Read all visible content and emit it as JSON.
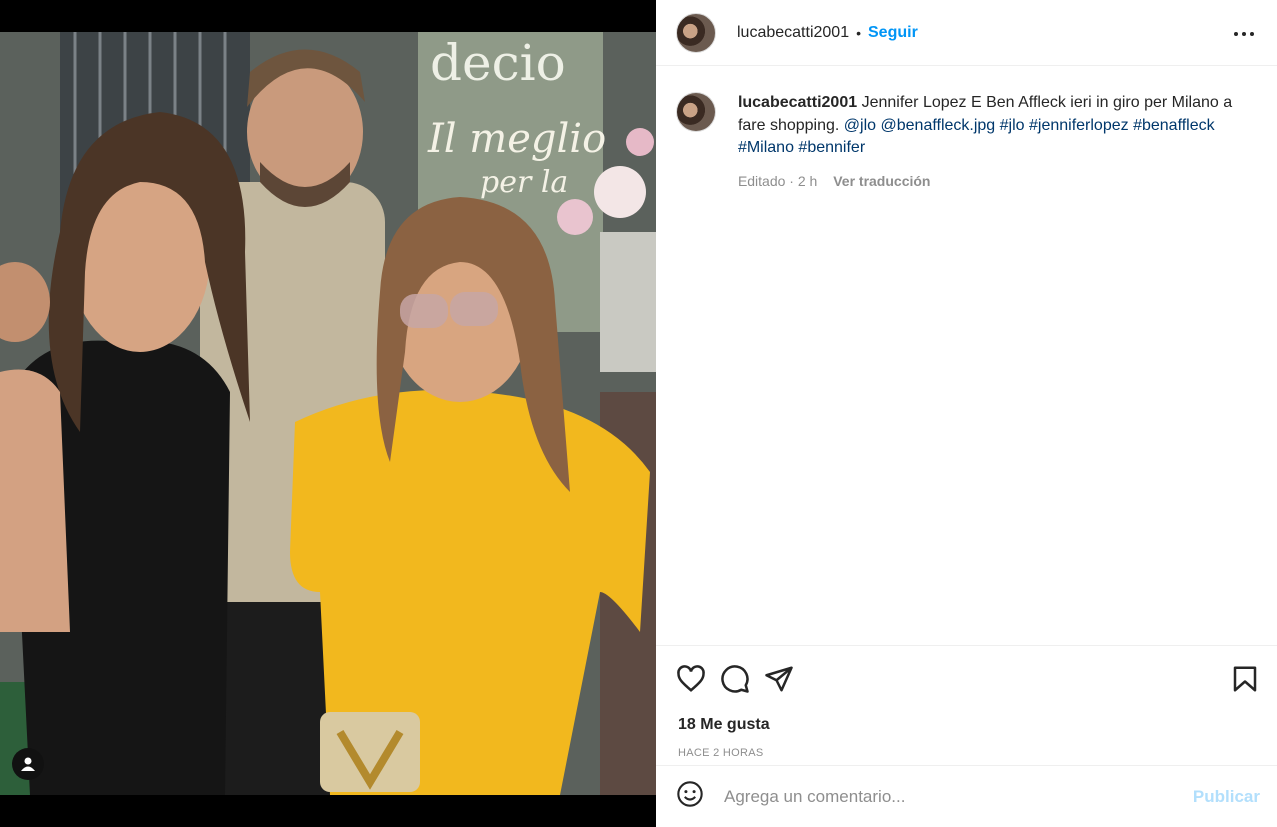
{
  "post": {
    "username": "lucabecatti2001",
    "dot": "•",
    "follow_label": "Seguir",
    "more_icon": "more-horizontal-icon"
  },
  "caption": {
    "username": "lucabecatti2001",
    "text": " Jennifer Lopez E Ben Affleck ieri in giro per Milano a fare shopping. ",
    "tags": [
      "@jlo",
      "@benaffleck.jpg",
      "#jlo",
      "#jenniferlopez",
      "#benaffleck",
      "#Milano",
      "#bennifer"
    ],
    "edited": "Editado · 2 h",
    "translate": "Ver traducción"
  },
  "photo": {
    "sign_line1": "decio",
    "sign_line2": "Il meglio",
    "sign_line3": "per la"
  },
  "actions": {
    "like_icon": "heart-icon",
    "comment_icon": "comment-icon",
    "share_icon": "send-icon",
    "save_icon": "bookmark-icon",
    "likes": "18 Me gusta",
    "ago": "HACE 2 HORAS"
  },
  "comment": {
    "placeholder": "Agrega un comentario...",
    "publish_label": "Publicar",
    "emoji_icon": "emoji-icon"
  },
  "colors": {
    "accent": "#0095f6",
    "publish_disabled": "#b2dffc",
    "link": "#00376b"
  }
}
